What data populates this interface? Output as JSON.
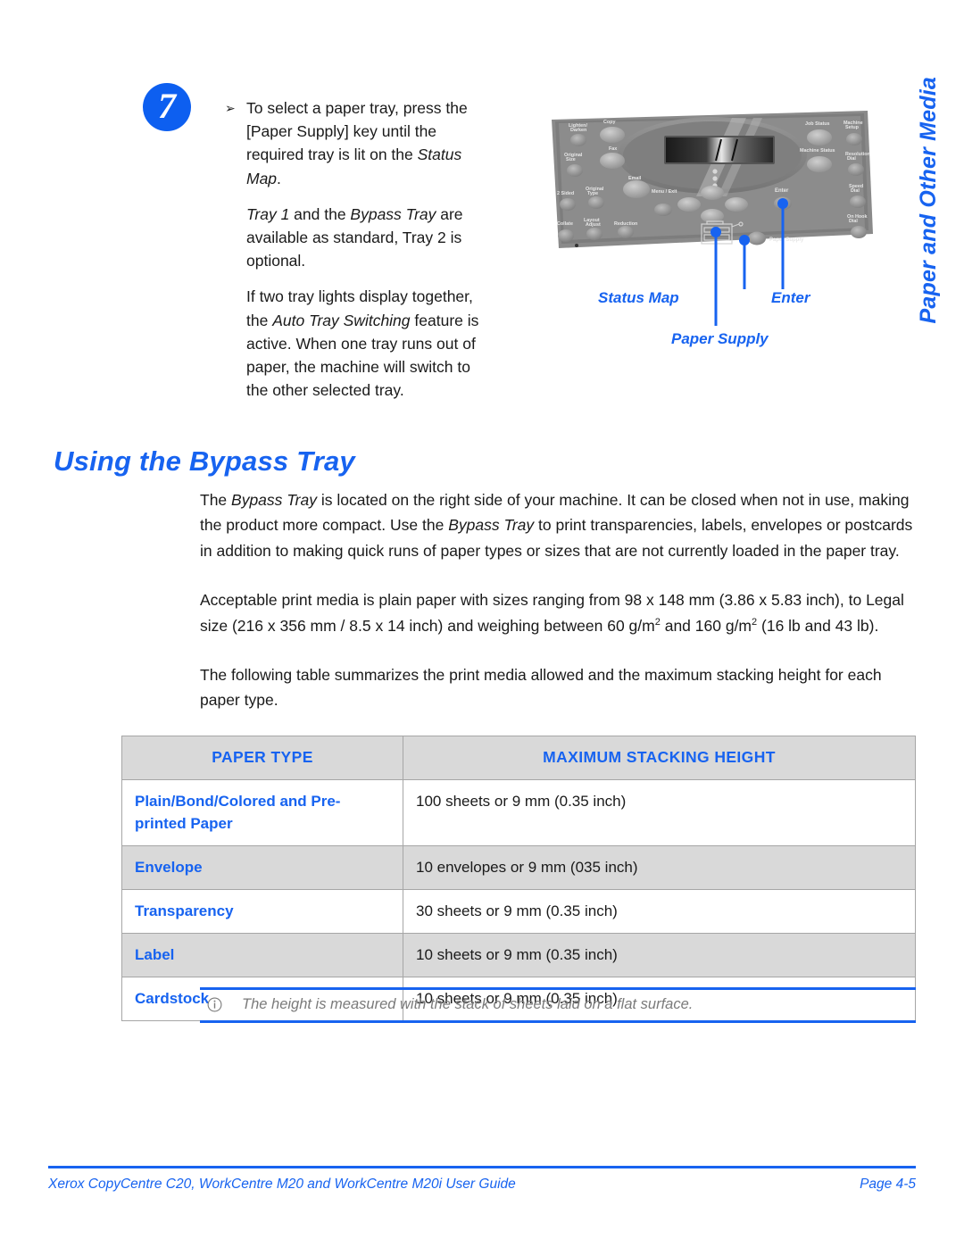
{
  "side_tab": {
    "text": "Paper and Other Media"
  },
  "step": {
    "number": "7",
    "bullet_glyph": "➢",
    "para1_a": "To select a paper tray, press the [Paper Supply] key until the required tray is lit on the ",
    "para1_em": "Status Map",
    "para1_b": ".",
    "para2_em1": "Tray 1",
    "para2_a": " and the ",
    "para2_em2": "Bypass Tray",
    "para2_b": " are available as standard, Tray 2 is optional.",
    "para3_a": "If two tray lights display together, the ",
    "para3_em": "Auto Tray Switching",
    "para3_b": " feature is active. When one tray runs out of paper, the machine will switch to the other selected tray."
  },
  "figure": {
    "name": "control-panel-photo",
    "callouts": [
      {
        "id": "status-map",
        "label": "Status Map"
      },
      {
        "id": "enter",
        "label": "Enter"
      },
      {
        "id": "paper-supply",
        "label": "Paper Supply"
      }
    ],
    "panel_buttons": [
      "Lighten/Darken",
      "Copy",
      "Fax",
      "Original Type",
      "Email",
      "2 Sided",
      "Collate",
      "Layout Adjust",
      "Reduction",
      "Job Status",
      "Machine Status",
      "Machine Setup",
      "Menu/Exit",
      "Enter",
      "Paper Supply"
    ],
    "accent_color": "#1763f0"
  },
  "heading": {
    "title": "Using the Bypass Tray"
  },
  "body": {
    "p1_a": "The ",
    "p1_em1": "Bypass Tray",
    "p1_b": " is located on the right side of your machine. It can be closed when not in use, making the product more compact. Use the ",
    "p1_em2": "Bypass Tray",
    "p1_c": " to print transparencies, labels, envelopes or postcards in addition to making quick runs of paper types or sizes that are not currently loaded in the paper tray.",
    "p2_a": "Acceptable print media is plain paper with sizes ranging from 98 x 148 mm (3.86 x 5.83 inch), to Legal size (216 x 356 mm / 8.5 x 14 inch) and weighing between 60 g/m",
    "p2_sup1": "2",
    "p2_b": " and 160 g/m",
    "p2_sup2": "2",
    "p2_c": " (16 lb and 43 lb).",
    "p3": "The following table summarizes the print media allowed and the maximum stacking height for each paper type."
  },
  "table": {
    "headers": [
      "PAPER TYPE",
      "MAXIMUM STACKING HEIGHT"
    ],
    "rows": [
      {
        "type": "Plain/Bond/Colored and Pre-printed Paper",
        "value": "100 sheets or 9 mm (0.35 inch)",
        "shaded": false
      },
      {
        "type": "Envelope",
        "value": "10 envelopes or 9 mm (035 inch)",
        "shaded": true
      },
      {
        "type": "Transparency",
        "value": "30 sheets or 9 mm (0.35 inch)",
        "shaded": false
      },
      {
        "type": "Label",
        "value": "10 sheets or 9 mm (0.35 inch)",
        "shaded": true
      },
      {
        "type": "Cardstock",
        "value": "10 sheets or 9 mm (0.35 inch)",
        "shaded": false
      }
    ]
  },
  "note": {
    "icon": "info-circle-icon",
    "text": "The height is measured with the stack of sheets laid on a flat surface."
  },
  "footer": {
    "left": "Xerox CopyCentre C20, WorkCentre M20 and WorkCentre M20i User Guide",
    "right": "Page 4-5"
  }
}
